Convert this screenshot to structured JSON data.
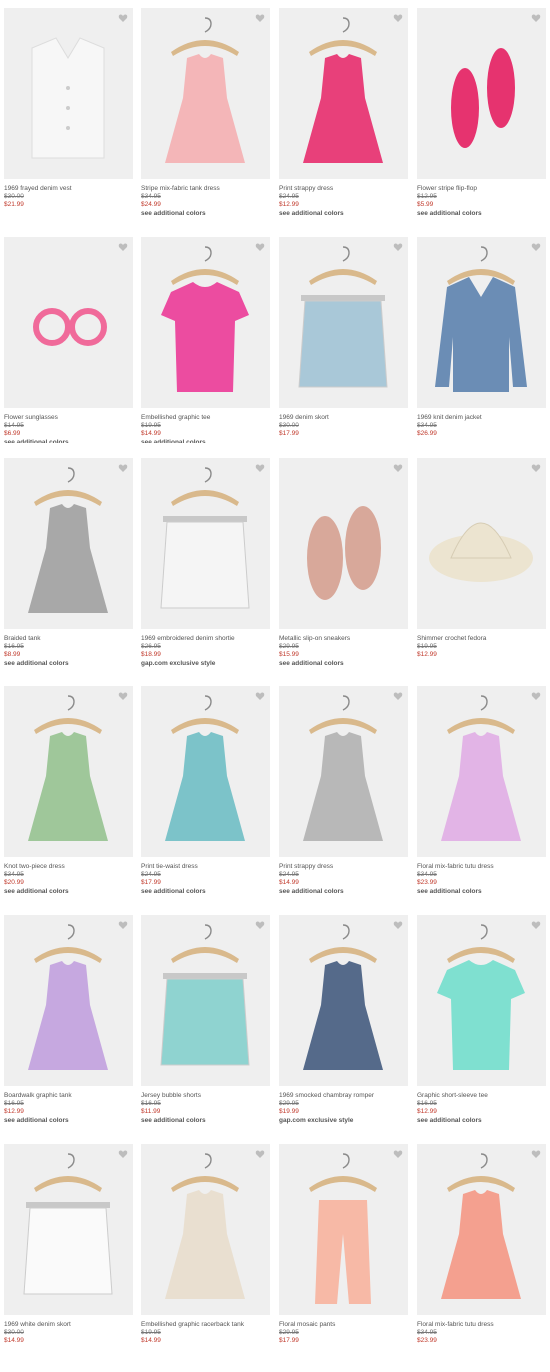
{
  "products": [
    {
      "name": "1969 frayed denim vest",
      "was": "$30.00",
      "now": "$21.99",
      "extra": "",
      "icon": "denim-vest-icon",
      "color": "#f7f7f7",
      "hanger": false
    },
    {
      "name": "Stripe mix-fabric tank dress",
      "was": "$34.95",
      "now": "$24.99",
      "extra": "see additional colors",
      "icon": "tank-dress-icon",
      "color": "#f4b6b8",
      "hanger": true
    },
    {
      "name": "Print strappy dress",
      "was": "$24.95",
      "now": "$12.99",
      "extra": "see additional colors",
      "icon": "strappy-dress-icon",
      "color": "#e8407a",
      "hanger": true
    },
    {
      "name": "Flower stripe flip-flop",
      "was": "$12.95",
      "now": "$5.99",
      "extra": "see additional colors",
      "icon": "flip-flop-icon",
      "color": "#e6336f",
      "hanger": false
    },
    {
      "name": "Flower sunglasses",
      "was": "$14.95",
      "now": "$6.99",
      "extra": "see additional colors",
      "icon": "sunglasses-icon",
      "color": "#f06a9a",
      "hanger": false
    },
    {
      "name": "Embellished graphic tee",
      "was": "$19.95",
      "now": "$14.99",
      "extra": "see additional colors",
      "icon": "graphic-tee-icon",
      "color": "#ec4ca0",
      "hanger": true
    },
    {
      "name": "1969 denim skort",
      "was": "$30.00",
      "now": "$17.99",
      "extra": "",
      "icon": "denim-skort-icon",
      "color": "#a9c8d8",
      "hanger": true
    },
    {
      "name": "1969 knit denim jacket",
      "was": "$34.95",
      "now": "$26.99",
      "extra": "",
      "icon": "denim-jacket-icon",
      "color": "#6b8db5",
      "hanger": true
    },
    {
      "name": "Braided tank",
      "was": "$16.95",
      "now": "$8.99",
      "extra": "see additional colors",
      "icon": "braided-tank-icon",
      "color": "#a8a8a8",
      "hanger": true
    },
    {
      "name": "1969 embroidered denim shortie",
      "was": "$26.95",
      "now": "$18.99",
      "extra": "gap.com exclusive style",
      "icon": "denim-shorts-icon",
      "color": "#f5f5f5",
      "hanger": true
    },
    {
      "name": "Metallic slip-on sneakers",
      "was": "$29.95",
      "now": "$15.99",
      "extra": "see additional colors",
      "icon": "sneakers-icon",
      "color": "#d8a89a",
      "hanger": false
    },
    {
      "name": "Shimmer crochet fedora",
      "was": "$19.95",
      "now": "$12.99",
      "extra": "",
      "icon": "fedora-icon",
      "color": "#ece4d0",
      "hanger": false
    },
    {
      "name": "Knot two-piece dress",
      "was": "$34.95",
      "now": "$20.99",
      "extra": "see additional colors",
      "icon": "plaid-dress-icon",
      "color": "#9fc79a",
      "hanger": true
    },
    {
      "name": "Print tie-waist dress",
      "was": "$24.95",
      "now": "$17.99",
      "extra": "see additional colors",
      "icon": "striped-dress-icon",
      "color": "#7cc3c9",
      "hanger": true
    },
    {
      "name": "Print strappy dress",
      "was": "$24.95",
      "now": "$14.99",
      "extra": "see additional colors",
      "icon": "floral-strappy-dress-icon",
      "color": "#b8b8b8",
      "hanger": true
    },
    {
      "name": "Floral mix-fabric tutu dress",
      "was": "$34.95",
      "now": "$23.99",
      "extra": "see additional colors",
      "icon": "tutu-dress-icon",
      "color": "#e2b4e6",
      "hanger": true
    },
    {
      "name": "Boardwalk graphic tank",
      "was": "$16.95",
      "now": "$12.99",
      "extra": "see additional colors",
      "icon": "graphic-tank-icon",
      "color": "#c6a8e0",
      "hanger": true
    },
    {
      "name": "Jersey bubble shorts",
      "was": "$16.95",
      "now": "$11.99",
      "extra": "see additional colors",
      "icon": "bubble-shorts-icon",
      "color": "#8fd3d0",
      "hanger": true
    },
    {
      "name": "1969 smocked chambray romper",
      "was": "$29.95",
      "now": "$19.99",
      "extra": "gap.com exclusive style",
      "icon": "romper-icon",
      "color": "#556a8a",
      "hanger": true
    },
    {
      "name": "Graphic short-sleeve tee",
      "was": "$16.95",
      "now": "$12.99",
      "extra": "see additional colors",
      "icon": "toucan-tee-icon",
      "color": "#7fe0d0",
      "hanger": true
    },
    {
      "name": "1969 white denim skort",
      "was": "$30.00",
      "now": "$14.99",
      "extra": "",
      "icon": "white-skort-icon",
      "color": "#fafafa",
      "hanger": true
    },
    {
      "name": "Embellished graphic racerback tank",
      "was": "$19.95",
      "now": "$14.99",
      "extra": "",
      "icon": "racerback-tank-icon",
      "color": "#e9dfd0",
      "hanger": true
    },
    {
      "name": "Floral mosaic pants",
      "was": "$29.95",
      "now": "$17.99",
      "extra": "",
      "icon": "floral-pants-icon",
      "color": "#f7b9a6",
      "hanger": true
    },
    {
      "name": "Floral mix-fabric tutu dress",
      "was": "$34.95",
      "now": "$23.99",
      "extra": "",
      "icon": "coral-tutu-dress-icon",
      "color": "#f4a08f",
      "hanger": true
    }
  ]
}
